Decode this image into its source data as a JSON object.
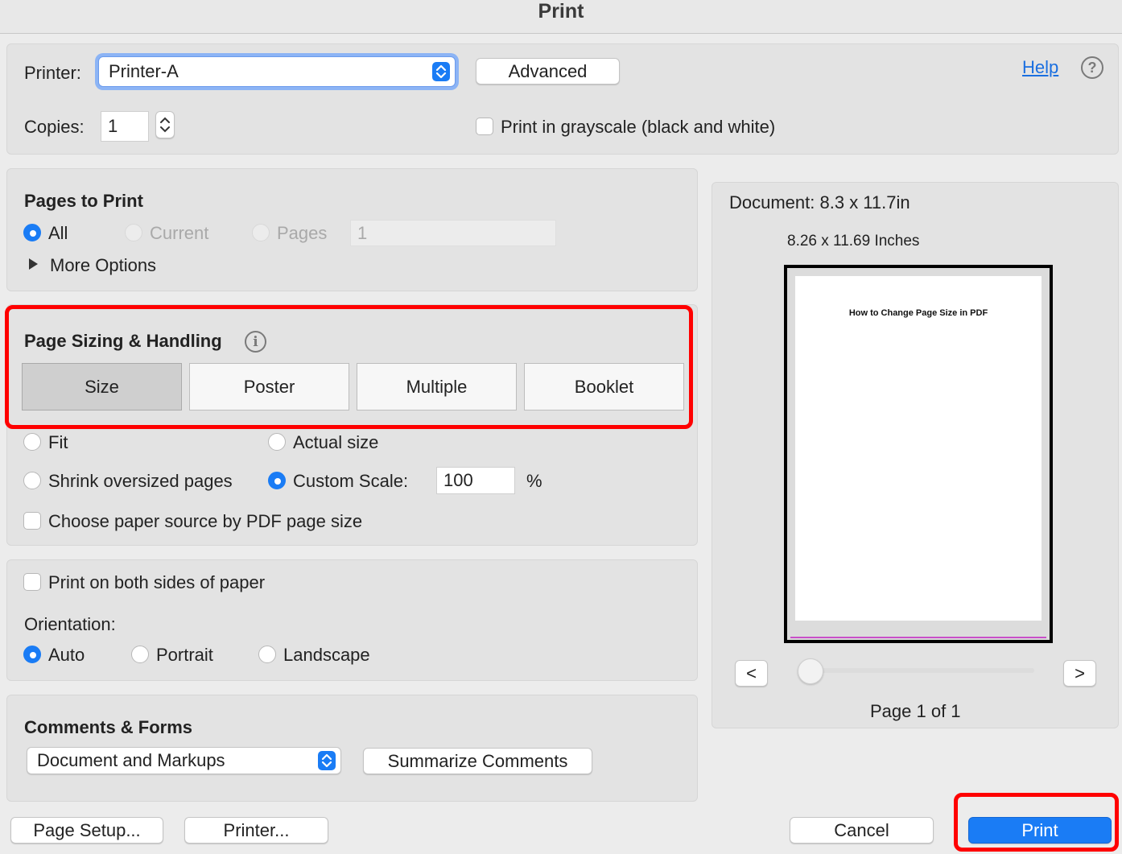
{
  "window": {
    "title": "Print"
  },
  "printer": {
    "label": "Printer:",
    "selected": "Printer-A",
    "advanced_label": "Advanced",
    "help_label": "Help",
    "copies_label": "Copies:",
    "copies_value": "1",
    "grayscale_label": "Print in grayscale (black and white)",
    "grayscale_checked": false
  },
  "pages_to_print": {
    "heading": "Pages to Print",
    "options": [
      "All",
      "Current",
      "Pages"
    ],
    "selected": "All",
    "pages_value": "1",
    "more_options_label": "More Options"
  },
  "page_sizing": {
    "heading": "Page Sizing & Handling",
    "tabs": [
      "Size",
      "Poster",
      "Multiple",
      "Booklet"
    ],
    "active_tab": "Size",
    "fit_label": "Fit",
    "actual_size_label": "Actual size",
    "shrink_label": "Shrink oversized pages",
    "custom_scale_label": "Custom Scale:",
    "custom_scale_value": "100",
    "percent_label": "%",
    "selected_option": "Custom Scale:",
    "paper_source_label": "Choose paper source by PDF page size",
    "paper_source_checked": false
  },
  "sides": {
    "both_sides_label": "Print on both sides of paper",
    "both_sides_checked": false,
    "orientation_label": "Orientation:",
    "orientation_options": [
      "Auto",
      "Portrait",
      "Landscape"
    ],
    "orientation_selected": "Auto"
  },
  "comments_forms": {
    "heading": "Comments & Forms",
    "selected": "Document and Markups",
    "summarize_label": "Summarize Comments"
  },
  "preview": {
    "document_size": "Document: 8.3 x 11.7in",
    "paper_size": "8.26 x 11.69 Inches",
    "page_text": "How to Change Page Size in PDF",
    "prev_label": "<",
    "next_label": ">",
    "page_indicator": "Page 1 of 1"
  },
  "footer": {
    "page_setup_label": "Page Setup...",
    "printer_label": "Printer...",
    "cancel_label": "Cancel",
    "print_label": "Print"
  },
  "colors": {
    "accent": "#1a7cf5",
    "highlight": "#ff0000"
  }
}
